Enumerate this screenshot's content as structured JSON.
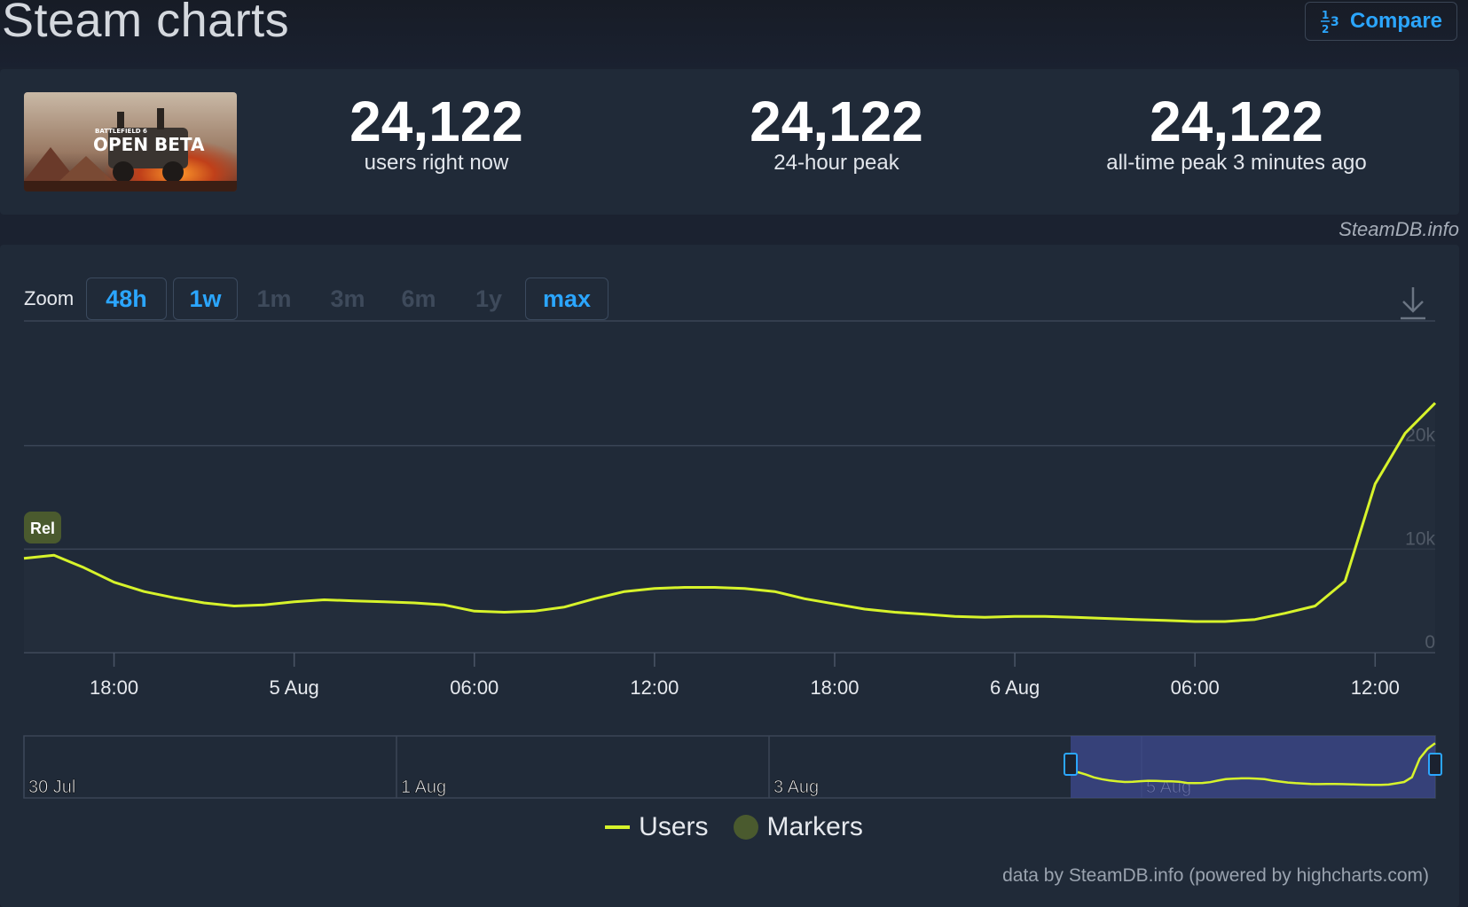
{
  "header": {
    "title": "Steam charts",
    "compare_label": "Compare"
  },
  "stats": {
    "cover_title": "OPEN BETA",
    "cover_subtitle": "BATTLEFIELD 6",
    "items": [
      {
        "value": "24,122",
        "label": "users right now"
      },
      {
        "value": "24,122",
        "label": "24-hour peak"
      },
      {
        "value": "24,122",
        "label": "all-time peak 3 minutes ago"
      }
    ]
  },
  "attribution": "SteamDB.info",
  "zoom": {
    "label": "Zoom",
    "options": [
      {
        "label": "48h",
        "enabled": true
      },
      {
        "label": "1w",
        "enabled": true
      },
      {
        "label": "1m",
        "enabled": false
      },
      {
        "label": "3m",
        "enabled": false
      },
      {
        "label": "6m",
        "enabled": false
      },
      {
        "label": "1y",
        "enabled": false
      },
      {
        "label": "max",
        "enabled": true
      }
    ]
  },
  "chart_data": {
    "type": "line",
    "title": "",
    "xlabel": "",
    "ylabel": "",
    "ylim": [
      0,
      30000
    ],
    "y_ticks": [
      0,
      10000,
      20000
    ],
    "y_tick_labels": [
      "0",
      "10k",
      "20k"
    ],
    "x_ticks": [
      "18:00",
      "5 Aug",
      "06:00",
      "12:00",
      "18:00",
      "6 Aug",
      "06:00",
      "12:00"
    ],
    "x_tick_hours": [
      3,
      9,
      15,
      21,
      27,
      33,
      39,
      45
    ],
    "grid": true,
    "legend_position": "bottom",
    "series": [
      {
        "name": "Users",
        "color": "#d7f32b",
        "points": [
          [
            0,
            9100
          ],
          [
            1,
            9400
          ],
          [
            2,
            8200
          ],
          [
            3,
            6800
          ],
          [
            4,
            5900
          ],
          [
            5,
            5300
          ],
          [
            6,
            4800
          ],
          [
            7,
            4500
          ],
          [
            8,
            4600
          ],
          [
            9,
            4900
          ],
          [
            10,
            5100
          ],
          [
            11,
            5000
          ],
          [
            12,
            4900
          ],
          [
            13,
            4800
          ],
          [
            14,
            4600
          ],
          [
            15,
            4000
          ],
          [
            16,
            3900
          ],
          [
            17,
            4000
          ],
          [
            18,
            4400
          ],
          [
            19,
            5200
          ],
          [
            20,
            5900
          ],
          [
            21,
            6200
          ],
          [
            22,
            6300
          ],
          [
            23,
            6300
          ],
          [
            24,
            6200
          ],
          [
            25,
            5900
          ],
          [
            26,
            5200
          ],
          [
            27,
            4700
          ],
          [
            28,
            4200
          ],
          [
            29,
            3900
          ],
          [
            30,
            3700
          ],
          [
            31,
            3500
          ],
          [
            32,
            3400
          ],
          [
            33,
            3500
          ],
          [
            34,
            3500
          ],
          [
            35,
            3400
          ],
          [
            36,
            3300
          ],
          [
            37,
            3200
          ],
          [
            38,
            3100
          ],
          [
            39,
            3000
          ],
          [
            40,
            3000
          ],
          [
            41,
            3200
          ],
          [
            42,
            3800
          ],
          [
            43,
            4500
          ],
          [
            44,
            6900
          ],
          [
            45,
            16300
          ],
          [
            46,
            21200
          ],
          [
            47,
            24122
          ]
        ]
      }
    ],
    "markers": [
      {
        "hour": 0,
        "label": "Rel"
      }
    ],
    "navigator": {
      "labels": [
        "30 Jul",
        "1 Aug",
        "3 Aug",
        "5 Aug"
      ]
    }
  },
  "legend": {
    "users_label": "Users",
    "markers_label": "Markers"
  },
  "credits": "data by SteamDB.info (powered by highcharts.com)"
}
